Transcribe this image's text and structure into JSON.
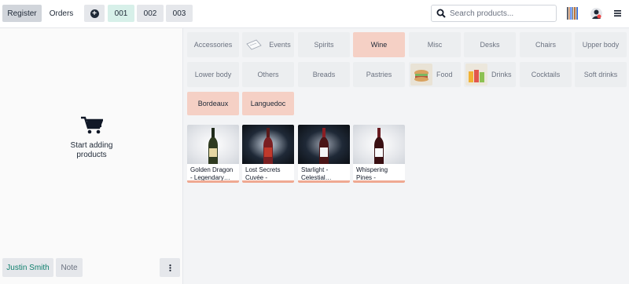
{
  "topbar": {
    "register_label": "Register",
    "orders_label": "Orders",
    "order_tabs": [
      {
        "label": "001",
        "active": true
      },
      {
        "label": "002",
        "active": false
      },
      {
        "label": "003",
        "active": false
      }
    ],
    "search_placeholder": "Search products...",
    "icons": [
      "plus-circle-icon",
      "search-icon",
      "barcode-icon",
      "user-avatar-icon",
      "hamburger-menu-icon"
    ]
  },
  "cart": {
    "empty_text_line1": "Start adding",
    "empty_text_line2": "products",
    "customer_label": "Justin Smith",
    "note_label": "Note"
  },
  "categories": {
    "row1": [
      "Accessories",
      "Events",
      "Spirits",
      "Wine",
      "Misc",
      "Desks",
      "Chairs",
      "Upper body"
    ],
    "row2": [
      "Lower body",
      "Others",
      "Breads",
      "Pastries",
      "Food",
      "Drinks",
      "Cocktails",
      "Soft drinks"
    ],
    "selected": "Wine",
    "subcategories": [
      "Bordeaux",
      "Languedoc"
    ]
  },
  "products": [
    {
      "name": "Golden Dragon - Legendary…"
    },
    {
      "name": "Lost Secrets Cuvée - Myster…"
    },
    {
      "name": "Starlight - Celestial…"
    },
    {
      "name": "Whispering Pines - Enchanted…"
    }
  ],
  "colors": {
    "accent_wine": "#f5d0c5",
    "customer_text": "#0e7f6d",
    "product_border": "#efa992"
  }
}
